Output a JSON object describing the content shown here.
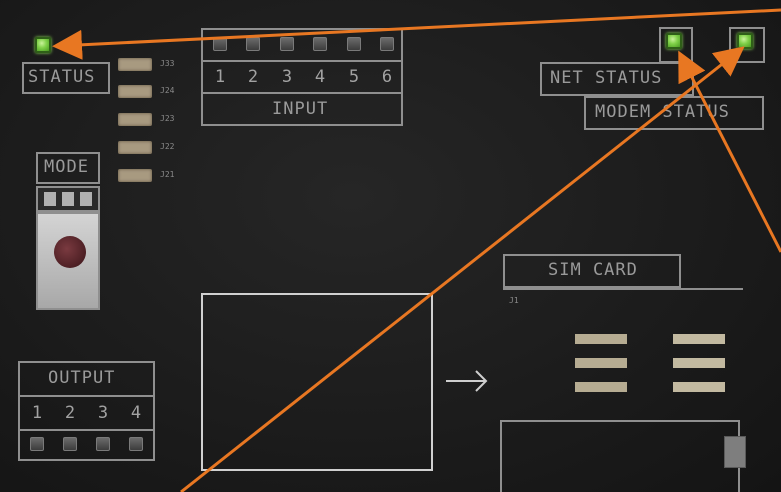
{
  "labels": {
    "status": "STATUS",
    "input": "INPUT",
    "net_status": "NET STATUS",
    "modem_status": "MODEM STATUS",
    "mode": "MODE",
    "output": "OUTPUT",
    "sim_card": "SIM CARD",
    "j1": "J1"
  },
  "resistor_codes": [
    "J33",
    "J24",
    "J23",
    "J22",
    "J21"
  ],
  "input_numbers": [
    "1",
    "2",
    "3",
    "4",
    "5",
    "6"
  ],
  "output_numbers": [
    "1",
    "2",
    "3",
    "4"
  ],
  "leds_lit": [
    "status",
    "net_status",
    "modem_status"
  ],
  "colors": {
    "board": "#1c1c1c",
    "silkscreen": "#9a9a9a",
    "led_on": "#7fd048",
    "callout_arrow": "#e87722"
  }
}
